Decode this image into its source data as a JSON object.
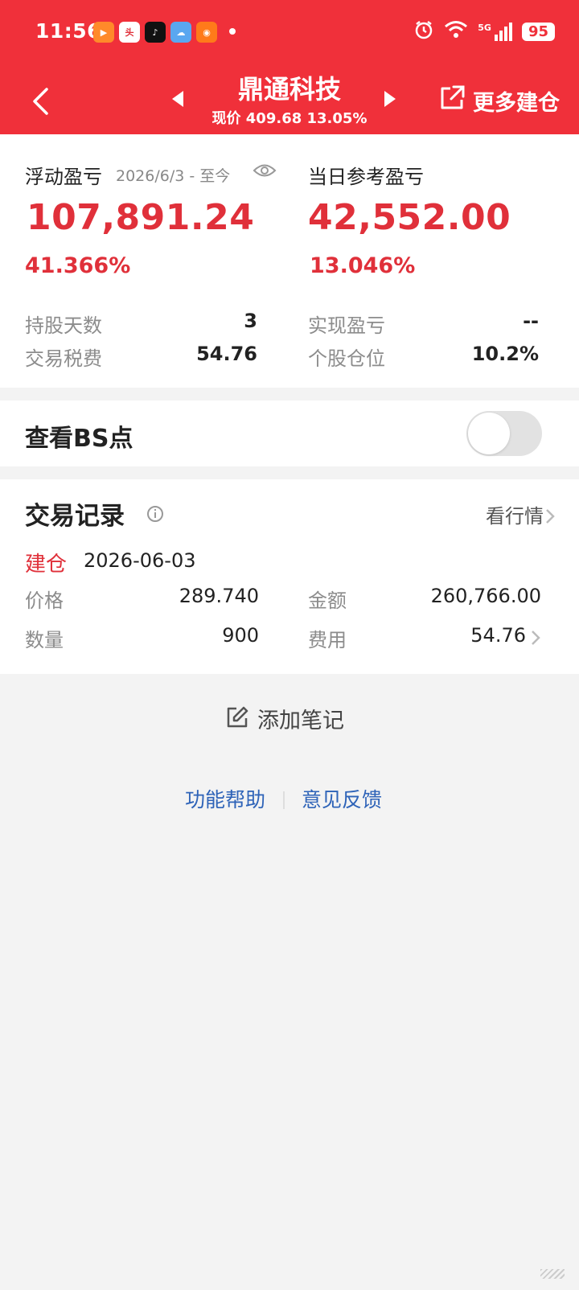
{
  "status": {
    "time": "11:56",
    "battery": "95",
    "network": "5G"
  },
  "header": {
    "title": "鼎通科技",
    "subtitle": "现价 409.68 13.05%",
    "more_label": "更多建仓"
  },
  "summary": {
    "floating_label": "浮动盈亏",
    "floating_period": "2026/6/3 - 至今",
    "floating_value": "107,891.24",
    "floating_pct": "41.366%",
    "daily_label": "当日参考盈亏",
    "daily_value": "42,552.00",
    "daily_pct": "13.046%",
    "hold_days_label": "持股天数",
    "hold_days_value": "3",
    "realized_label": "实现盈亏",
    "realized_value": "--",
    "tax_label": "交易税费",
    "tax_value": "54.76",
    "position_label": "个股仓位",
    "position_value": "10.2%"
  },
  "bs": {
    "label": "查看BS点",
    "enabled": false
  },
  "records": {
    "title": "交易记录",
    "view_market": "看行情",
    "entry_type": "建仓",
    "entry_date": "2026-06-03",
    "price_label": "价格",
    "price_value": "289.740",
    "amount_label": "金额",
    "amount_value": "260,766.00",
    "qty_label": "数量",
    "qty_value": "900",
    "fee_label": "费用",
    "fee_value": "54.76"
  },
  "note": {
    "label": "添加笔记"
  },
  "footer": {
    "help": "功能帮助",
    "feedback": "意见反馈"
  },
  "colors": {
    "header_bg": "#f0303a",
    "positive": "#e0303a",
    "link": "#2e63b8"
  }
}
